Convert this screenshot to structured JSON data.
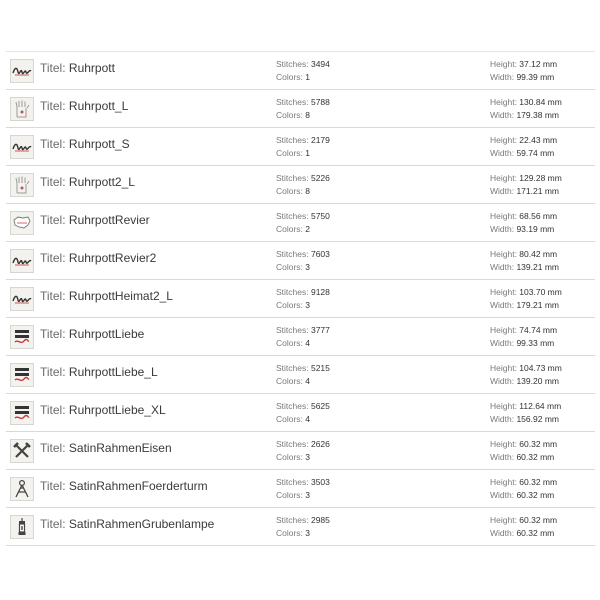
{
  "labels": {
    "title": "Titel: ",
    "stitches": "Stitches: ",
    "colors": "Colors: ",
    "height": "Height: ",
    "width": "Width: "
  },
  "rows": [
    {
      "title": "Ruhrpott",
      "stitches": "3494",
      "colors": "1",
      "height": "37.12 mm",
      "width": "99.39 mm",
      "icon": "script-logo-icon"
    },
    {
      "title": "Ruhrpott_L",
      "stitches": "5788",
      "colors": "8",
      "height": "130.84 mm",
      "width": "179.38 mm",
      "icon": "glove-icon"
    },
    {
      "title": "Ruhrpott_S",
      "stitches": "2179",
      "colors": "1",
      "height": "22.43 mm",
      "width": "59.74 mm",
      "icon": "script-logo-icon"
    },
    {
      "title": "Ruhrpott2_L",
      "stitches": "5226",
      "colors": "8",
      "height": "129.28 mm",
      "width": "171.21 mm",
      "icon": "glove-icon"
    },
    {
      "title": "RuhrpottRevier",
      "stitches": "5750",
      "colors": "2",
      "height": "68.56 mm",
      "width": "93.19 mm",
      "icon": "map-outline-icon"
    },
    {
      "title": "RuhrpottRevier2",
      "stitches": "7603",
      "colors": "3",
      "height": "80.42 mm",
      "width": "139.21 mm",
      "icon": "script-logo-icon"
    },
    {
      "title": "RuhrpottHeimat2_L",
      "stitches": "9128",
      "colors": "3",
      "height": "103.70 mm",
      "width": "179.21 mm",
      "icon": "script-logo-icon"
    },
    {
      "title": "RuhrpottLiebe",
      "stitches": "3777",
      "colors": "4",
      "height": "74.74 mm",
      "width": "99.33 mm",
      "icon": "text-logo-icon"
    },
    {
      "title": "RuhrpottLiebe_L",
      "stitches": "5215",
      "colors": "4",
      "height": "104.73 mm",
      "width": "139.20 mm",
      "icon": "text-logo-icon"
    },
    {
      "title": "RuhrpottLiebe_XL",
      "stitches": "5625",
      "colors": "4",
      "height": "112.64 mm",
      "width": "156.92 mm",
      "icon": "text-logo-icon"
    },
    {
      "title": "SatinRahmenEisen",
      "stitches": "2626",
      "colors": "3",
      "height": "60.32 mm",
      "width": "60.32 mm",
      "icon": "hammer-pick-icon"
    },
    {
      "title": "SatinRahmenFoerderturm",
      "stitches": "3503",
      "colors": "3",
      "height": "60.32 mm",
      "width": "60.32 mm",
      "icon": "mine-tower-icon"
    },
    {
      "title": "SatinRahmenGrubenlampe",
      "stitches": "2985",
      "colors": "3",
      "height": "60.32 mm",
      "width": "60.32 mm",
      "icon": "mining-lamp-icon"
    }
  ]
}
